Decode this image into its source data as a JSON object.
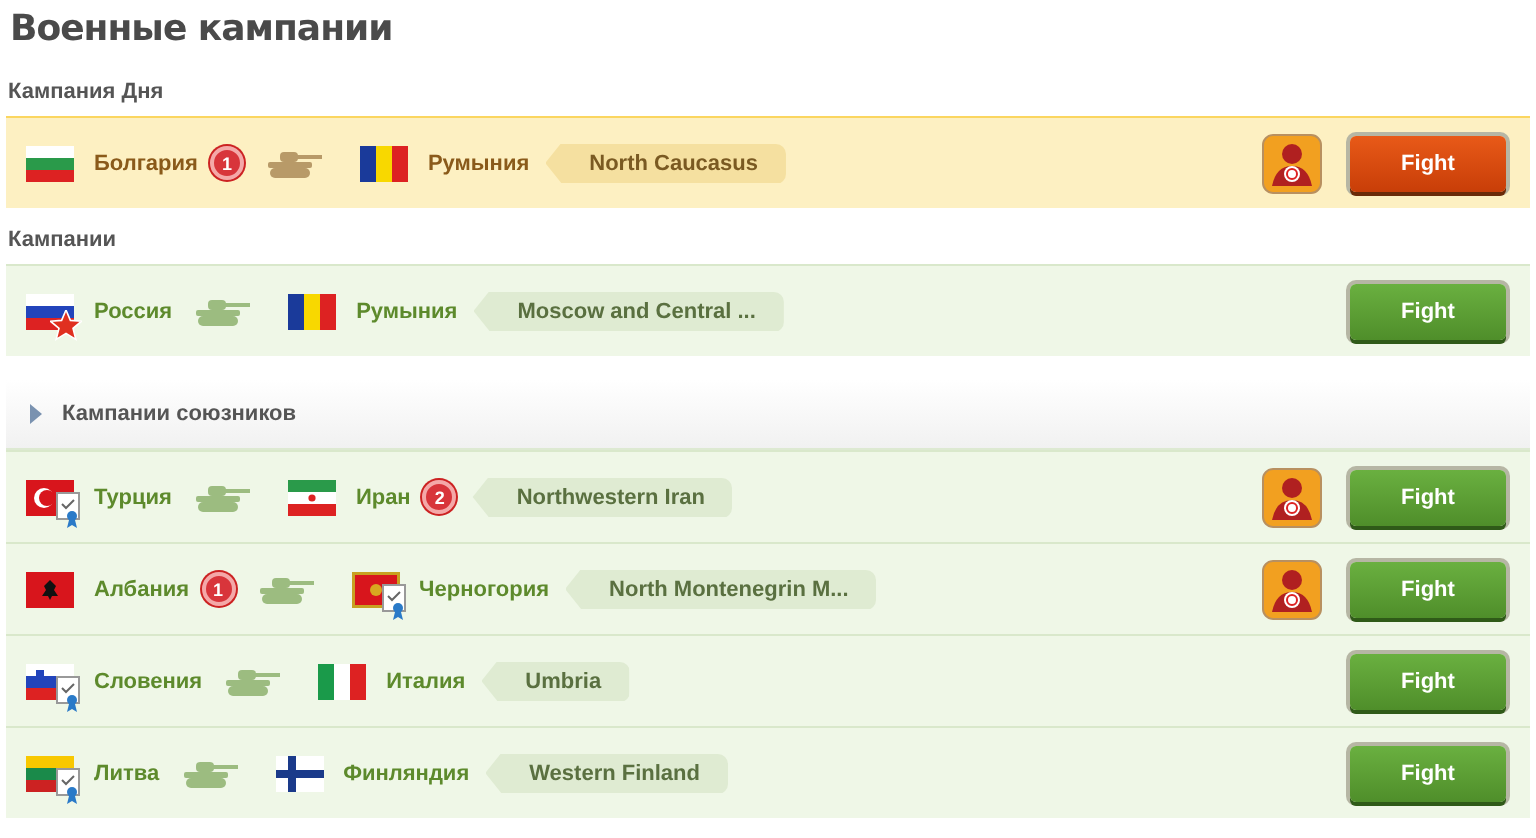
{
  "title": "Военные кампании",
  "sections": [
    {
      "title": "Кампания Дня",
      "kind": "daily",
      "campaigns": [
        {
          "attacker": {
            "name": "Болгария",
            "flag": {
              "kind": "bg"
            },
            "count": "1"
          },
          "defender": {
            "name": "Румыния",
            "flag": {
              "kind": "ro"
            }
          },
          "region": "North Caucasus",
          "bounty": true,
          "button": "Fight"
        }
      ]
    },
    {
      "title": "Кампании",
      "kind": "plain",
      "campaigns": [
        {
          "attacker": {
            "name": "Россия",
            "flag": {
              "kind": "ru"
            },
            "badge": {
              "kind": "star"
            }
          },
          "defender": {
            "name": "Румыния",
            "flag": {
              "kind": "ro"
            }
          },
          "region": "Moscow and Central ...",
          "bounty": false,
          "button": "Fight"
        }
      ]
    },
    {
      "title": "Кампании союзников",
      "kind": "allies",
      "campaigns": [
        {
          "attacker": {
            "name": "Турция",
            "flag": {
              "kind": "tr"
            },
            "badge": {
              "kind": "ally"
            }
          },
          "defender": {
            "name": "Иран",
            "flag": {
              "kind": "ir"
            },
            "count": "2"
          },
          "region": "Northwestern Iran",
          "bounty": true,
          "button": "Fight"
        },
        {
          "attacker": {
            "name": "Албания",
            "flag": {
              "kind": "al"
            },
            "count": "1"
          },
          "defender": {
            "name": "Черногория",
            "flag": {
              "kind": "me"
            },
            "badge": {
              "kind": "ally"
            }
          },
          "region": "North Montenegrin M...",
          "bounty": true,
          "button": "Fight"
        },
        {
          "attacker": {
            "name": "Словения",
            "flag": {
              "kind": "si"
            },
            "badge": {
              "kind": "ally"
            }
          },
          "defender": {
            "name": "Италия",
            "flag": {
              "kind": "it"
            }
          },
          "region": "Umbria",
          "bounty": false,
          "button": "Fight"
        },
        {
          "attacker": {
            "name": "Литва",
            "flag": {
              "kind": "lt"
            },
            "badge": {
              "kind": "ally"
            }
          },
          "defender": {
            "name": "Финляндия",
            "flag": {
              "kind": "fi"
            }
          },
          "region": "Western Finland",
          "bounty": false,
          "button": "Fight"
        }
      ]
    }
  ]
}
